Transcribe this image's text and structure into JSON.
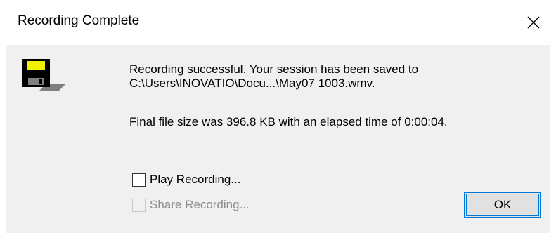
{
  "window": {
    "title": "Recording Complete",
    "close_icon": "close-icon"
  },
  "message": {
    "icon": "floppy-disk-icon",
    "line1": "Recording successful.  Your session has been saved to",
    "line2": "C:\\Users\\INOVATIO\\Docu...\\May07 1003.wmv.",
    "line3": "Final file size was 396.8 KB with an elapsed time of 0:00:04."
  },
  "options": {
    "play_label": "Play Recording...",
    "play_checked": false,
    "share_label": "Share Recording...",
    "share_checked": false,
    "share_enabled": false
  },
  "buttons": {
    "ok_label": "OK"
  },
  "colors": {
    "dialog_background": "#f0f0f0",
    "button_focus_border": "#0078d7",
    "disabled_text": "#8d8d8d"
  }
}
